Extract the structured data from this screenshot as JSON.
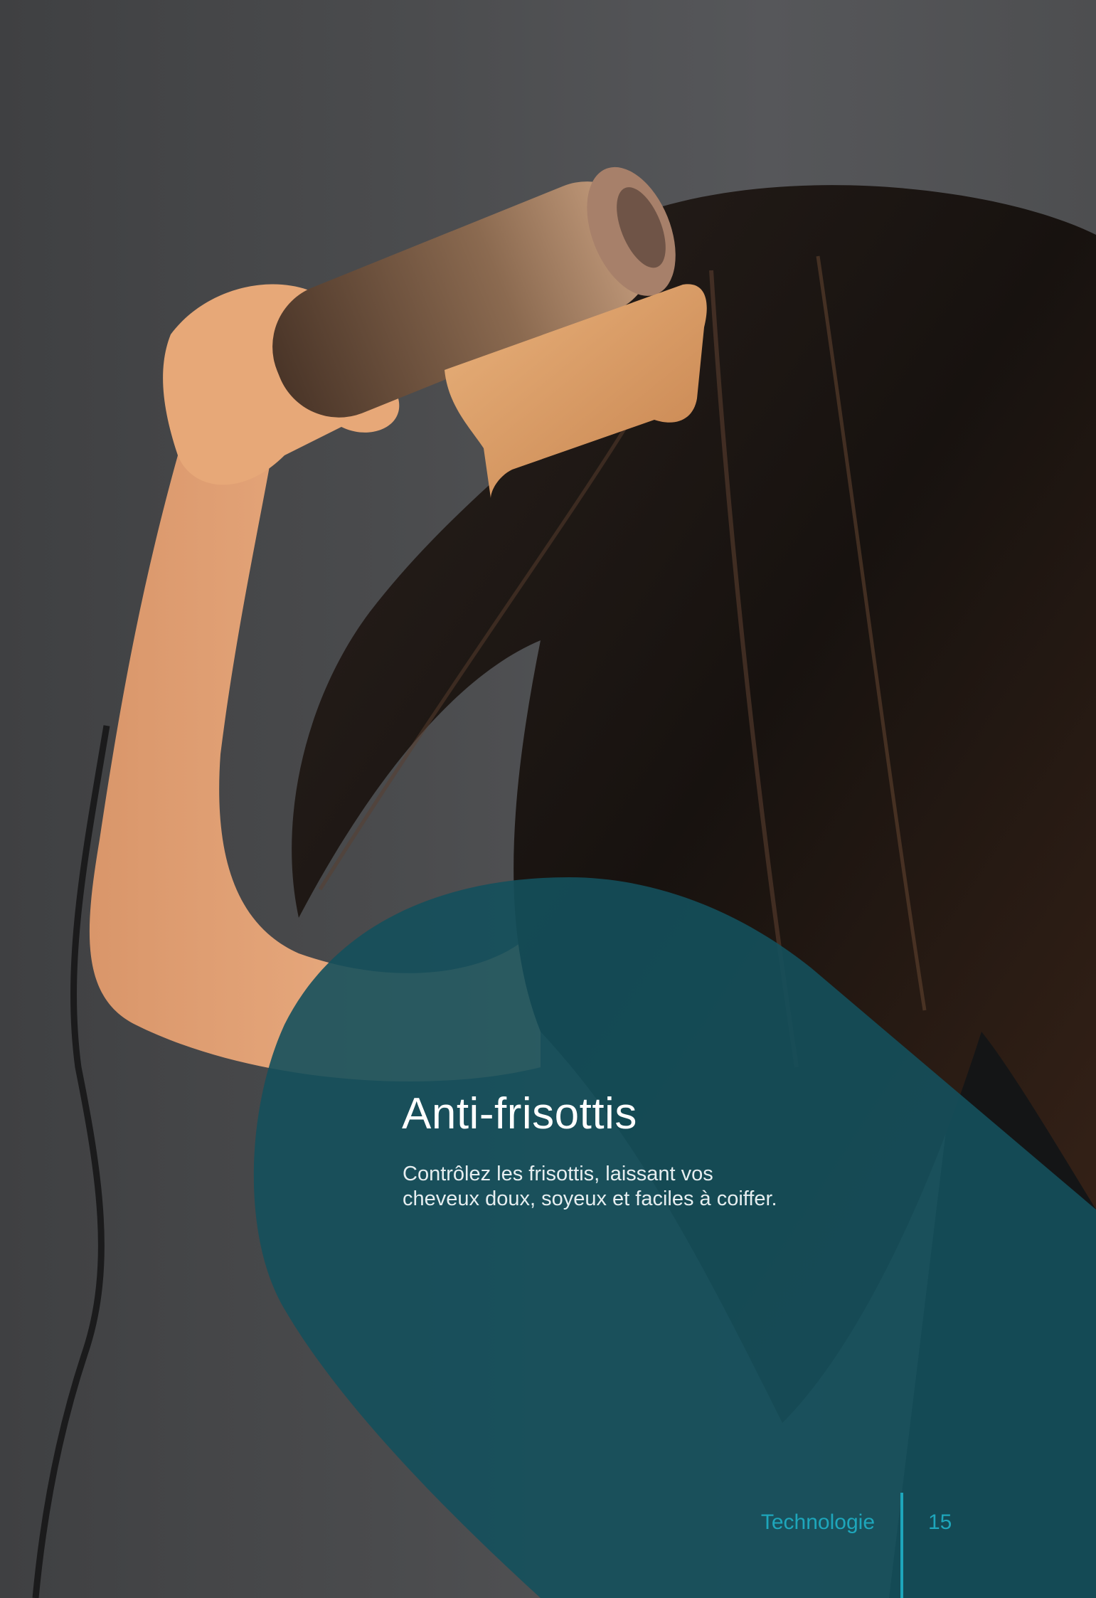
{
  "heading": "Anti-frisottis",
  "description": {
    "line1": "Contrôlez les frisottis, laissant vos",
    "line2": "cheveux doux, soyeux et faciles à coiffer."
  },
  "footer": {
    "section": "Technologie",
    "page_number": "15"
  },
  "colors": {
    "accent": "#1ea6bb",
    "panel": "#14505c",
    "background": "#4b4c4e"
  }
}
